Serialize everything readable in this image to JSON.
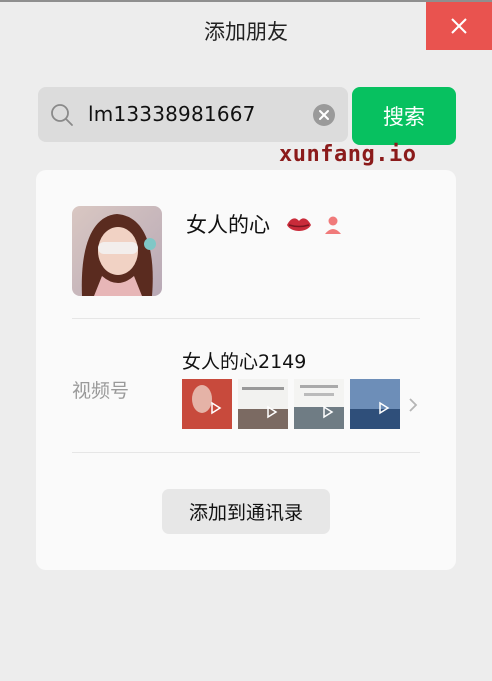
{
  "window": {
    "title": "添加朋友",
    "close_icon": "close-icon",
    "close_color": "#e9534f"
  },
  "search": {
    "value": "lm13338981667",
    "button_label": "搜索",
    "button_color": "#07c160",
    "search_icon": "search-icon",
    "clear_icon": "clear-icon"
  },
  "watermark": "xunfang.io",
  "profile": {
    "nickname": "女人的心",
    "emoji_icon": "lips-icon",
    "gender_icon": "female-icon",
    "gender_color": "#f07a7a"
  },
  "channels": {
    "label": "视频号",
    "account_name": "女人的心2149",
    "thumbnail_count": 4,
    "more_icon": "chevron-right-icon"
  },
  "actions": {
    "add_contact_label": "添加到通讯录"
  }
}
